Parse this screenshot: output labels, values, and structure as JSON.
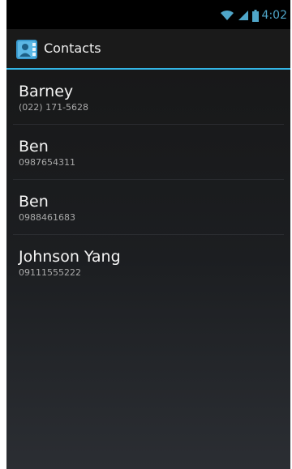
{
  "status_bar": {
    "time": "4:02",
    "icons": [
      "wifi-icon",
      "signal-icon",
      "battery-icon"
    ]
  },
  "action_bar": {
    "icon": "contacts-icon",
    "title": "Contacts"
  },
  "contacts": [
    {
      "name": "Barney",
      "phone": "(022) 171-5628"
    },
    {
      "name": "Ben",
      "phone": "0987654311"
    },
    {
      "name": "Ben",
      "phone": "0988461683"
    },
    {
      "name": "Johnson Yang",
      "phone": "09111555222"
    }
  ],
  "colors": {
    "accent": "#33b5e5",
    "status_time": "#4fa6c9",
    "background": "#1c1e21"
  }
}
